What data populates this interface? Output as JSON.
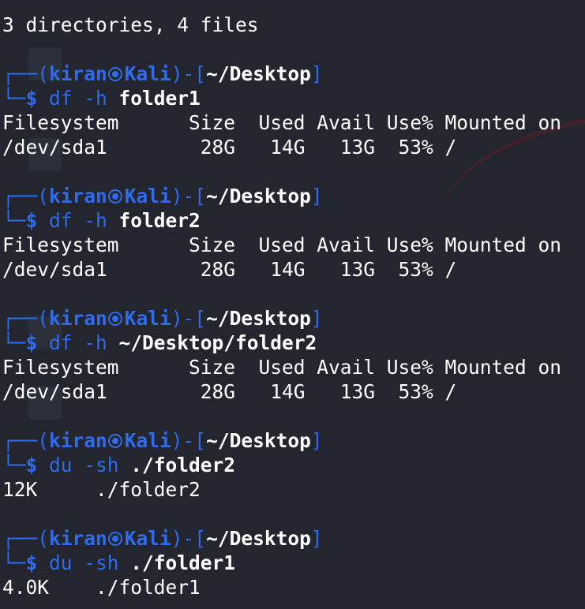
{
  "colors": {
    "background": "#23262e",
    "prompt_accent": "#2f6bea",
    "text": "#ffffff"
  },
  "prompt": {
    "frame_top": "┌──(",
    "user": "kiran",
    "host": "Kali",
    "frame_mid": ")-[",
    "path": "~/Desktop",
    "frame_end": "]",
    "frame_bottom": "└─",
    "dollar": "$ "
  },
  "summary": "3 directories, 4 files",
  "blocks": [
    {
      "cmd": "df -h ",
      "arg": "folder1",
      "output": [
        "Filesystem      Size  Used Avail Use% Mounted on",
        "/dev/sda1        28G   14G   13G  53% /"
      ]
    },
    {
      "cmd": "df -h ",
      "arg": "folder2",
      "output": [
        "Filesystem      Size  Used Avail Use% Mounted on",
        "/dev/sda1        28G   14G   13G  53% /"
      ]
    },
    {
      "cmd": "df -h ",
      "arg": "~/Desktop/folder2",
      "output": [
        "Filesystem      Size  Used Avail Use% Mounted on",
        "/dev/sda1        28G   14G   13G  53% /"
      ]
    },
    {
      "cmd": "du -sh ",
      "arg": "./folder2",
      "output": [
        "12K     ./folder2"
      ]
    },
    {
      "cmd": "du -sh ",
      "arg": "./folder1",
      "output": [
        "4.0K    ./folder1"
      ]
    }
  ]
}
